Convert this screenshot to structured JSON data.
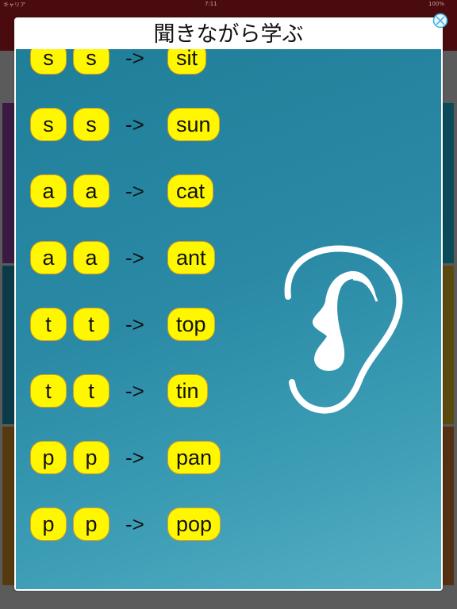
{
  "status_bar": {
    "carrier": "キャリア",
    "time": "7:11",
    "battery": "100%"
  },
  "modal": {
    "title": "聞きながら学ぶ",
    "close_icon": "close-circle-x-icon",
    "illustration_icon": "ear-icon",
    "rows": [
      {
        "letter1": "s",
        "letter2": "s",
        "arrow": "->",
        "word": "sit"
      },
      {
        "letter1": "s",
        "letter2": "s",
        "arrow": "->",
        "word": "sun"
      },
      {
        "letter1": "a",
        "letter2": "a",
        "arrow": "->",
        "word": "cat"
      },
      {
        "letter1": "a",
        "letter2": "a",
        "arrow": "->",
        "word": "ant"
      },
      {
        "letter1": "t",
        "letter2": "t",
        "arrow": "->",
        "word": "top"
      },
      {
        "letter1": "t",
        "letter2": "t",
        "arrow": "->",
        "word": "tin"
      },
      {
        "letter1": "p",
        "letter2": "p",
        "arrow": "->",
        "word": "pan"
      },
      {
        "letter1": "p",
        "letter2": "p",
        "arrow": "->",
        "word": "pop"
      }
    ]
  },
  "colors": {
    "chip_fill": "#fff700",
    "chip_border": "#d9a020",
    "content_bg": "#2a8aa6",
    "top_bar": "#4a0b0f"
  }
}
